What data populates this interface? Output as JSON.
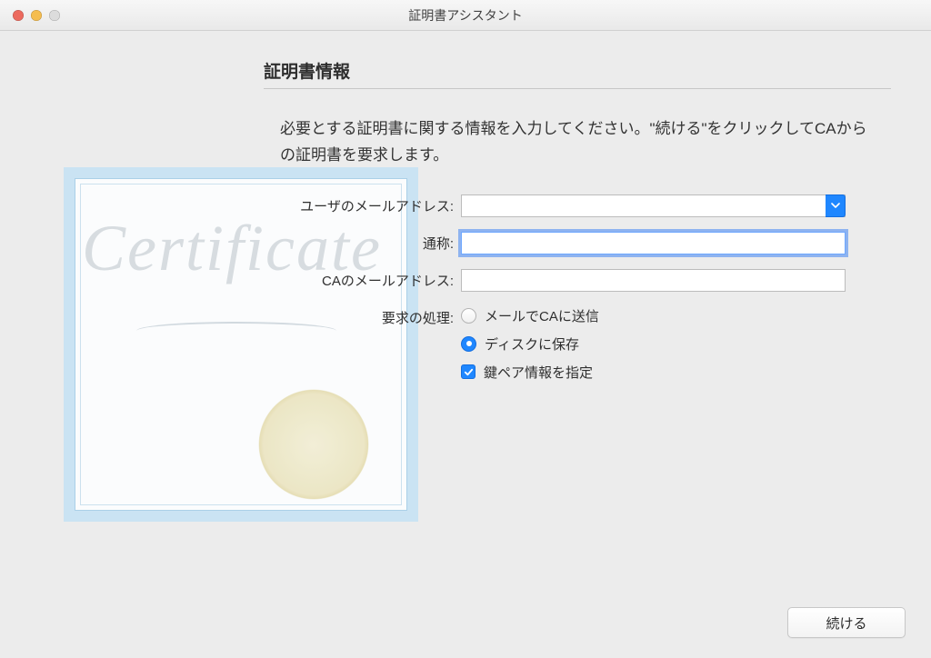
{
  "window": {
    "title": "証明書アシスタント"
  },
  "heading": "証明書情報",
  "instructions": "必要とする証明書に関する情報を入力してください。\"続ける\"をクリックしてCAからの証明書を要求します。",
  "form": {
    "user_email": {
      "label": "ユーザのメールアドレス:",
      "value": ""
    },
    "common_name": {
      "label": "通称:",
      "value": ""
    },
    "ca_email": {
      "label": "CAのメールアドレス:",
      "value": ""
    },
    "request_handling": {
      "label": "要求の処理:",
      "option_send_by_mail": "メールでCAに送信",
      "option_save_to_disk": "ディスクに保存",
      "selected": "save_to_disk",
      "option_specify_keypair": "鍵ペア情報を指定",
      "specify_keypair_checked": true
    }
  },
  "certificate_art": {
    "script_text": "Certificate"
  },
  "footer": {
    "continue_label": "続ける"
  }
}
